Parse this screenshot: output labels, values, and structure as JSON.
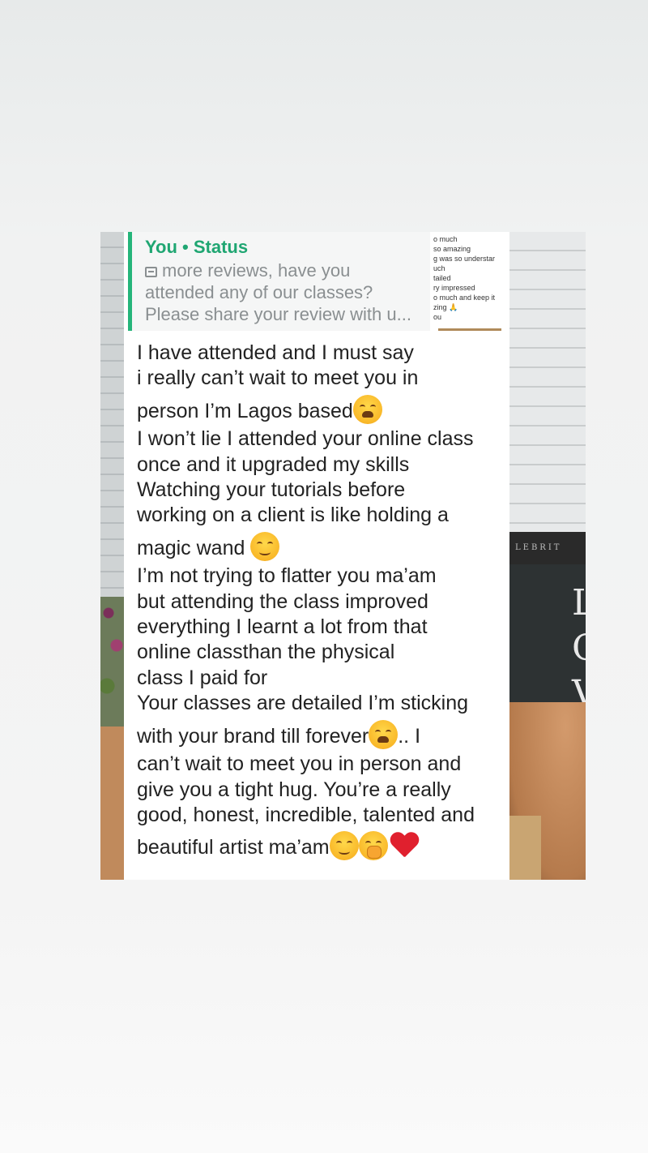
{
  "reply_quote": {
    "author": "You • Status",
    "icon": "image-icon",
    "lines": [
      "more reviews, have you",
      "attended any of our classes?",
      "Please share your review with u..."
    ]
  },
  "thumbnail": {
    "lines": [
      "o much",
      "so amazing",
      "g was so understar",
      "uch",
      "tailed",
      "ry impressed",
      "o much and keep it",
      "zing 🙏",
      "ou"
    ]
  },
  "background": {
    "sign_text": "LEBRIT",
    "sign_letters": [
      "L",
      "O",
      "V"
    ]
  },
  "message": {
    "lines": [
      {
        "text": "I have attended and I must say"
      },
      {
        "text": "i really can’t wait to meet you in"
      },
      {
        "text": "person I’m Lagos based",
        "emojis": [
          "weary-face"
        ]
      },
      {
        "text": "I won’t lie I attended your online class"
      },
      {
        "text": "once and it upgraded my skills"
      },
      {
        "text": "Watching your tutorials before"
      },
      {
        "text": "working on a client is like holding a"
      },
      {
        "text": "magic wand ",
        "emojis": [
          "smiling-face"
        ]
      },
      {
        "text": "I’m not trying to flatter you ma’am"
      },
      {
        "text": "but attending the class improved"
      },
      {
        "text": "everything I learnt a lot from that"
      },
      {
        "text": "online classthan the physical"
      },
      {
        "text": "class I paid for"
      },
      {
        "text": "Your classes are detailed I’m sticking"
      },
      {
        "text": "with your brand till forever",
        "emojis": [
          "weary-face"
        ],
        "after": ".. I"
      },
      {
        "text": "can’t wait to meet you in person and"
      },
      {
        "text": "give you a tight hug. You’re a really"
      },
      {
        "text": "good, honest, incredible, talented and"
      },
      {
        "text": "beautiful artist ma’am",
        "emojis": [
          "smiling-face",
          "shushing-face",
          "red-heart"
        ]
      }
    ]
  },
  "colors": {
    "accent": "#25b57a",
    "author_text": "#1fa672",
    "quote_text": "#8a8f91",
    "message_text": "#222222",
    "heart": "#e0202e"
  }
}
